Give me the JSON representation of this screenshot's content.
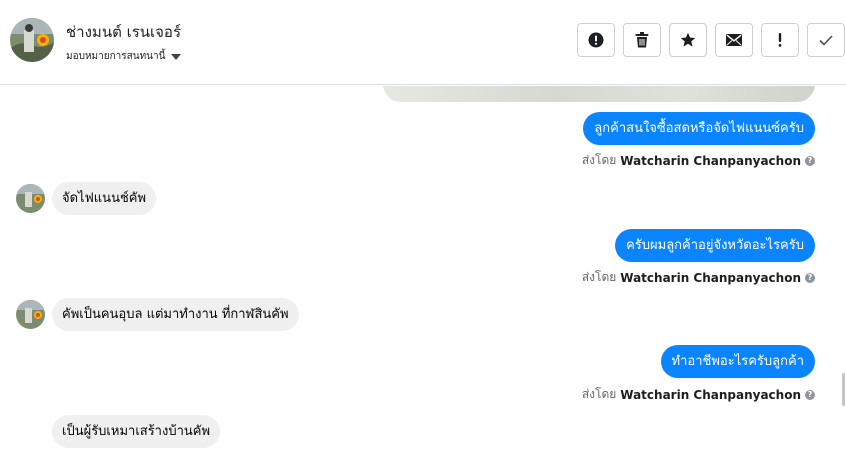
{
  "header": {
    "contact_name": "ช่างมนต์ เรนเจอร์",
    "assign_label": "มอบหมายการสนทนานี้"
  },
  "actions": [
    {
      "name": "spam-button",
      "icon": "alert-circle-icon"
    },
    {
      "name": "delete-button",
      "icon": "trash-icon"
    },
    {
      "name": "star-button",
      "icon": "star-icon"
    },
    {
      "name": "mark-unread-button",
      "icon": "envelope-icon"
    },
    {
      "name": "mark-important-button",
      "icon": "exclamation-icon"
    },
    {
      "name": "mark-done-button",
      "icon": "check-icon"
    }
  ],
  "messages": [
    {
      "direction": "out",
      "text": "ลูกค้าสนใจซื้อสดหรือจัดไฟแนนซ์ครับ",
      "sent_by_prefix": "ส่งโดย",
      "sender": "Watcharin Chanpanyachon"
    },
    {
      "direction": "in",
      "text": "จัดไฟแนนช์คัพ"
    },
    {
      "direction": "out",
      "text": "ครับผมลูกค้าอยู่จังหวัดอะไรครับ",
      "sent_by_prefix": "ส่งโดย",
      "sender": "Watcharin Chanpanyachon"
    },
    {
      "direction": "in",
      "text": "คัพเป็นคนอุบล แต่มาทำงาน ที่กาฬสินคัพ"
    },
    {
      "direction": "out",
      "text": "ทำอาชีพอะไรครับลูกค้า",
      "sent_by_prefix": "ส่งโดย",
      "sender": "Watcharin Chanpanyachon"
    },
    {
      "direction": "in",
      "text": "เป็นผู้รับเหมาเสร้างบ้านคัพ"
    }
  ],
  "colors": {
    "outgoing_bubble": "#0b84ff",
    "incoming_bubble": "#f0f0f0",
    "sent_by_text": "#65676b"
  }
}
